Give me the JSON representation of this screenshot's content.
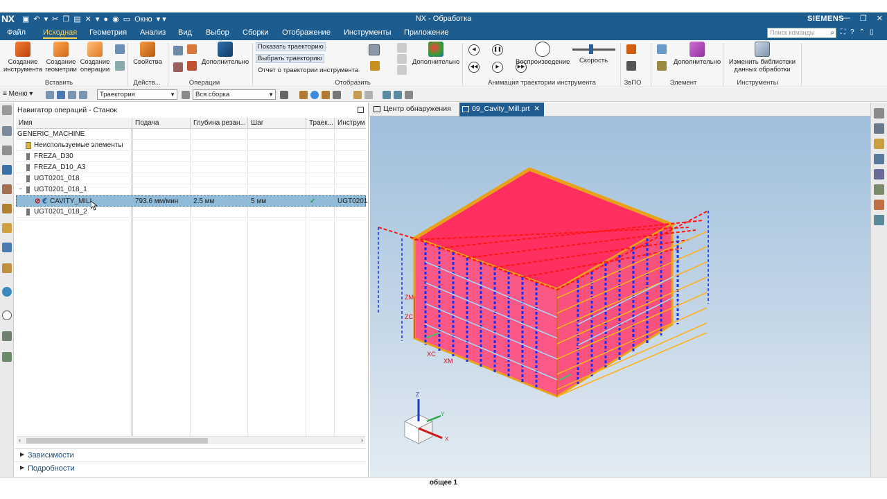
{
  "titlebar": {
    "logo": "NX",
    "window_menu": "Окно",
    "title": "NX - Обработка",
    "brand": "SIEMENS"
  },
  "menubar": {
    "items": [
      "Файл",
      "Исходная",
      "Геометрия",
      "Анализ",
      "Вид",
      "Выбор",
      "Сборки",
      "Отображение",
      "Инструменты",
      "Приложение"
    ],
    "active_index": 1,
    "search_placeholder": "Поиск команды"
  },
  "ribbon": {
    "insert": {
      "create_tool": "Создание инструмента",
      "create_geometry": "Создание геометрии",
      "create_operation": "Создание операции",
      "label": "Вставить"
    },
    "actions": {
      "properties": "Свойства",
      "label": "Действ..."
    },
    "operations": {
      "more": "Дополнительно",
      "label": "Операции"
    },
    "display": {
      "show_path": "Показать траекторию",
      "select_path": "Выбрать траекторию",
      "report": "Отчет о траектории инструмента",
      "more": "Дополнительно",
      "label": "Отобразить"
    },
    "animation": {
      "playback": "Воспроизведение",
      "speed": "Скорость",
      "label": "Анимация траектории инструмента"
    },
    "vpo": {
      "label": "ЗвПО"
    },
    "element": {
      "more": "Дополнительно",
      "label": "Элемент"
    },
    "tools": {
      "change_libs": "Изменить библиотеки данных обработки",
      "label": "Инструменты"
    }
  },
  "toolbar2": {
    "menu": "Меню",
    "filter_value": "Траектория",
    "assembly_value": "Вся сборка"
  },
  "navigator": {
    "title": "Навигатор операций - Станок",
    "columns": [
      "Имя",
      "Подача",
      "Глубина резан...",
      "Шаг",
      "Траек...",
      "Инструм"
    ],
    "rows": [
      {
        "name": "GENERIC_MACHINE",
        "feed": "",
        "depth": "",
        "step": "",
        "path": "",
        "tool": ""
      },
      {
        "name": "Неиспользуемые элементы",
        "feed": "",
        "depth": "",
        "step": "",
        "path": "",
        "tool": ""
      },
      {
        "name": "FREZA_D30",
        "feed": "",
        "depth": "",
        "step": "",
        "path": "",
        "tool": ""
      },
      {
        "name": "FREZA_D10_A3",
        "feed": "",
        "depth": "",
        "step": "",
        "path": "",
        "tool": ""
      },
      {
        "name": "UGT0201_018",
        "feed": "",
        "depth": "",
        "step": "",
        "path": "",
        "tool": ""
      },
      {
        "name": "UGT0201_018_1",
        "feed": "",
        "depth": "",
        "step": "",
        "path": "",
        "tool": ""
      },
      {
        "name": "CAVITY_MILL",
        "feed": "793.6 мм/мин",
        "depth": "2.5 мм",
        "step": "5 мм",
        "path": "✓",
        "tool": "UGT0201"
      },
      {
        "name": "UGT0201_018_2",
        "feed": "",
        "depth": "",
        "step": "",
        "path": "",
        "tool": ""
      }
    ],
    "panels": [
      "Зависимости",
      "Подробности"
    ]
  },
  "viewtabs": [
    "Центр обнаружения",
    "09_Cavity_Mill.prt"
  ],
  "viewport": {
    "axis_labels": [
      "ZM",
      "ZC",
      "XC",
      "XM",
      "Z",
      "Y",
      "X"
    ],
    "colors": {
      "part_top": "#ff3366",
      "part_edge": "#e8a21a",
      "toolpath_red": "#ff1111",
      "toolpath_blue": "#1030ff",
      "toolpath_orange": "#ffb020",
      "toolpath_cyan": "#6fd6ff"
    }
  },
  "status": "общее 1"
}
